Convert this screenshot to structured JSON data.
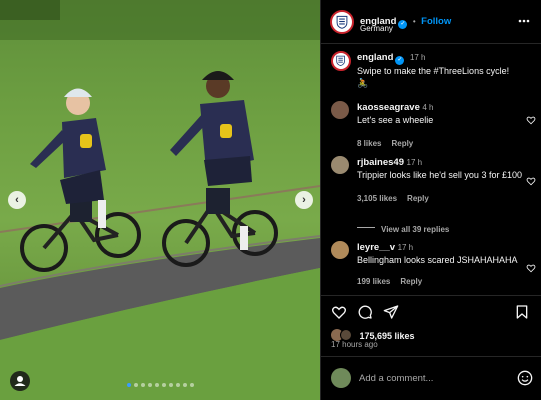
{
  "post": {
    "account": "england",
    "follow_label": "Follow",
    "location": "Germany",
    "more_icon": "more-horizontal-icon"
  },
  "caption": {
    "username": "england",
    "time": "17 h",
    "text": "Swipe to make the #ThreeLions cycle! 🚴"
  },
  "comments": [
    {
      "username": "kaosseagrave",
      "time": "4 h",
      "text": "Let's see a wheelie",
      "likes": "8 likes",
      "reply": "Reply"
    },
    {
      "username": "rjbaines49",
      "time": "17 h",
      "text": "Trippier looks like he'd sell you 3 for £100",
      "likes": "3,105 likes",
      "reply": "Reply",
      "view_replies": "View all 39 replies"
    },
    {
      "username": "leyre__v",
      "time": "17 h",
      "text": "Bellingham looks scared JSHAHAHAHA",
      "likes": "199 likes",
      "reply": "Reply"
    }
  ],
  "actions": {
    "likes": "175,695 likes",
    "timestamp": "17 hours ago"
  },
  "add_comment": {
    "placeholder": "Add a comment..."
  },
  "carousel": {
    "total": 10,
    "active": 1
  },
  "colors": {
    "accent": "#0095f6",
    "background": "#000000",
    "divider": "#262626"
  }
}
